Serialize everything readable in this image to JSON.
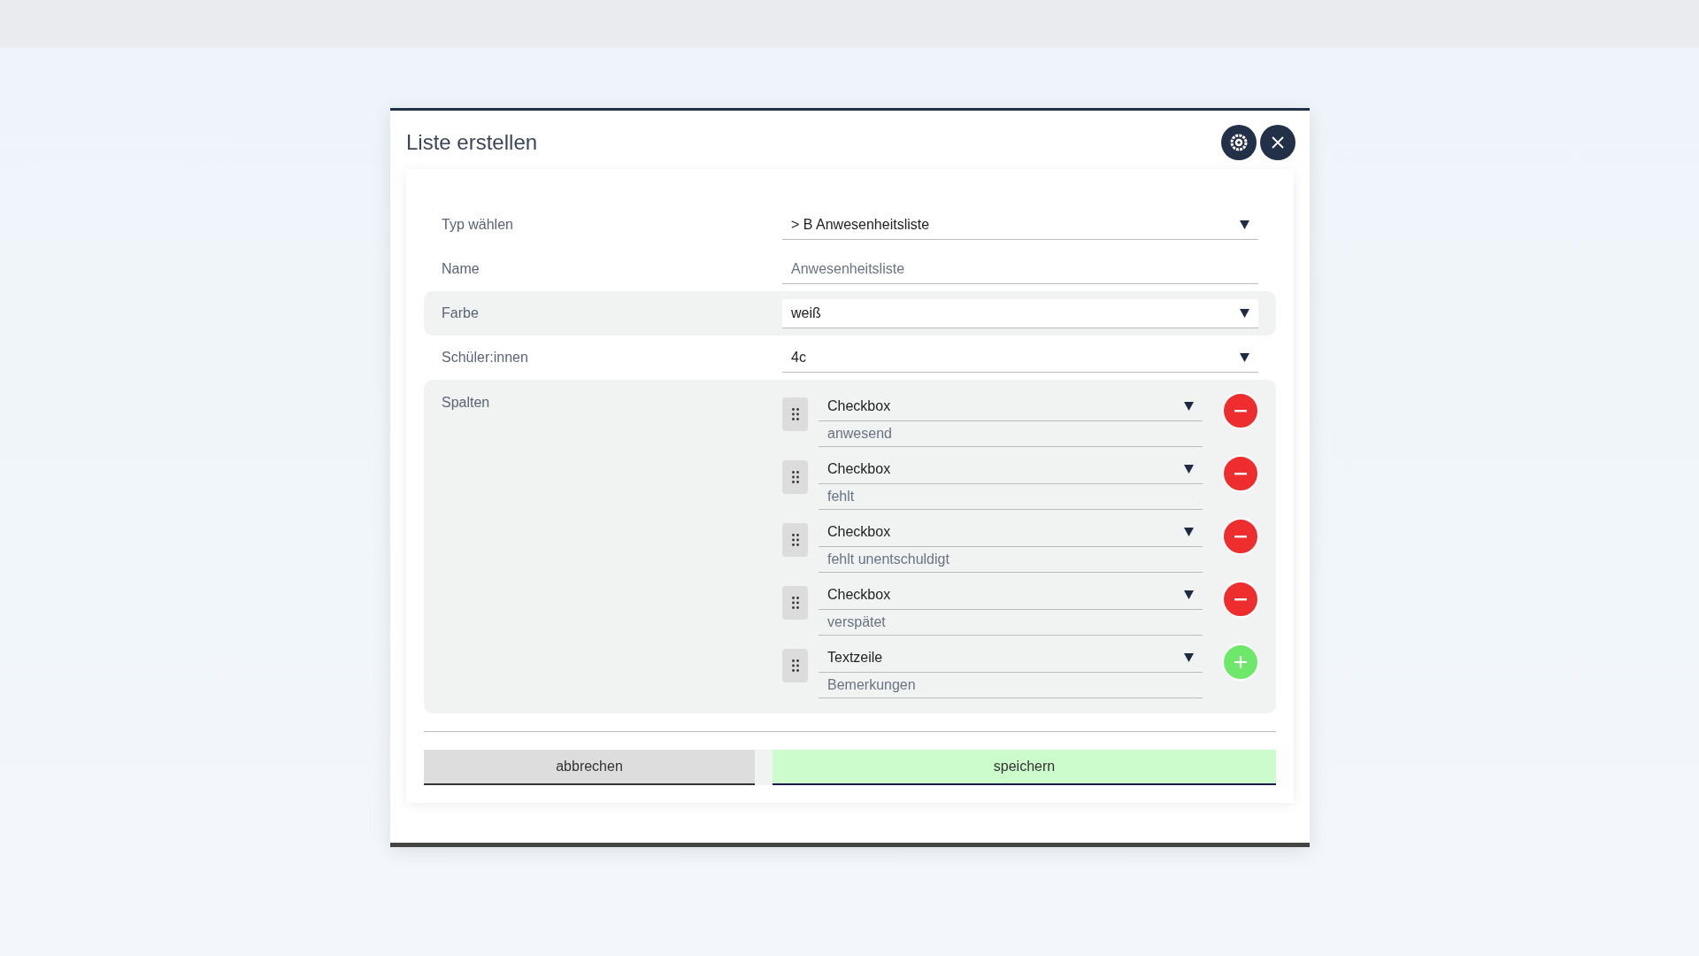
{
  "dialog": {
    "title": "Liste erstellen"
  },
  "fields": [
    {
      "kind": "select",
      "label": "Typ wählen",
      "value": "> B Anwesenheitsliste",
      "highlighted": false
    },
    {
      "kind": "text",
      "label": "Name",
      "value": "Anwesenheitsliste",
      "highlighted": false
    },
    {
      "kind": "select",
      "label": "Farbe",
      "value": "weiß",
      "highlighted": true
    },
    {
      "kind": "select",
      "label": "Schüler:innen",
      "value": "4c",
      "highlighted": false
    }
  ],
  "columns": {
    "label": "Spalten",
    "items": [
      {
        "type": "Checkbox",
        "name": "anwesend",
        "kind": "remove"
      },
      {
        "type": "Checkbox",
        "name": "fehlt",
        "kind": "remove"
      },
      {
        "type": "Checkbox",
        "name": "fehlt unentschuldigt",
        "kind": "remove"
      },
      {
        "type": "Checkbox",
        "name": "verspätet",
        "kind": "remove"
      },
      {
        "type": "Textzeile",
        "name": "Bemerkungen",
        "kind": "add"
      }
    ]
  },
  "buttons": [
    {
      "kind": "cancel",
      "label": "abbrechen"
    },
    {
      "kind": "save",
      "label": "speichern"
    }
  ]
}
